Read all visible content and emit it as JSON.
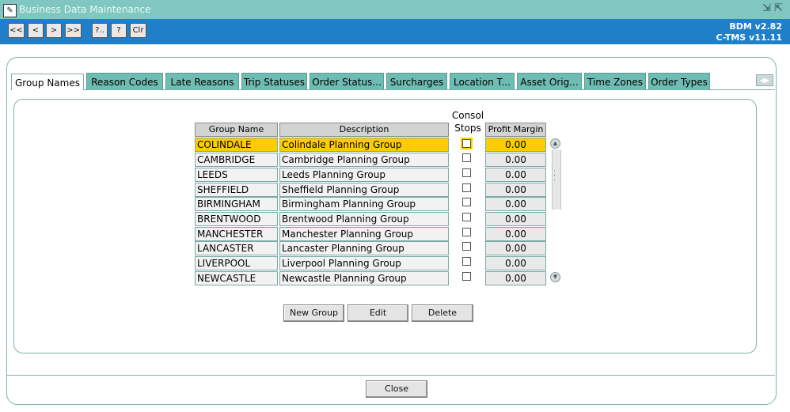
{
  "window": {
    "title": "Business Data Maintenance",
    "minimize_glyph": "⇲",
    "maximize_glyph": "⇱",
    "app_icon": "app-logo-icon"
  },
  "toolbar": {
    "buttons": [
      "<<",
      "<",
      ">",
      ">>",
      "?..",
      "?",
      "Clr"
    ],
    "version": "BDM v2.82",
    "product": "C-TMS v11.11"
  },
  "tabs": [
    {
      "label": "Group Names",
      "active": true
    },
    {
      "label": "Reason Codes"
    },
    {
      "label": "Late Reasons"
    },
    {
      "label": "Trip Statuses"
    },
    {
      "label": "Order Status..."
    },
    {
      "label": "Surcharges"
    },
    {
      "label": "Location T..."
    },
    {
      "label": "Asset Orig..."
    },
    {
      "label": "Time Zones"
    },
    {
      "label": "Order Types"
    }
  ],
  "table": {
    "headers": {
      "group_name": "Group Name",
      "description": "Description",
      "consol_stops": "Consol\nStops",
      "profit_margin": "Profit Margin"
    },
    "rows": [
      {
        "group": "COLINDALE",
        "description": "Colindale Planning Group",
        "consol": false,
        "margin": "0.00"
      },
      {
        "group": "CAMBRIDGE",
        "description": "Cambridge Planning Group",
        "consol": false,
        "margin": "0.00"
      },
      {
        "group": "LEEDS",
        "description": "Leeds Planning Group",
        "consol": false,
        "margin": "0.00"
      },
      {
        "group": "SHEFFIELD",
        "description": "Sheffield Planning Group",
        "consol": false,
        "margin": "0.00"
      },
      {
        "group": "BIRMINGHAM",
        "description": "Birmingham Planning Group",
        "consol": false,
        "margin": "0.00"
      },
      {
        "group": "BRENTWOOD",
        "description": "Brentwood Planning Group",
        "consol": false,
        "margin": "0.00"
      },
      {
        "group": "MANCHESTER",
        "description": "Manchester Planning Group",
        "consol": false,
        "margin": "0.00"
      },
      {
        "group": "LANCASTER",
        "description": "Lancaster Planning Group",
        "consol": false,
        "margin": "0.00"
      },
      {
        "group": "LIVERPOOL",
        "description": "Liverpool Planning Group",
        "consol": false,
        "margin": "0.00"
      },
      {
        "group": "NEWCASTLE",
        "description": "Newcastle Planning Group",
        "consol": false,
        "margin": "0.00"
      }
    ],
    "selected_row": 0
  },
  "actions": {
    "new_group": "New Group",
    "edit": "Edit",
    "delete": "Delete",
    "close": "Close"
  },
  "colors": {
    "title_bar": "#7fc7c0",
    "toolbar": "#1f7fc8",
    "tab": "#6fbcb3",
    "selection": "#ffcc00"
  }
}
